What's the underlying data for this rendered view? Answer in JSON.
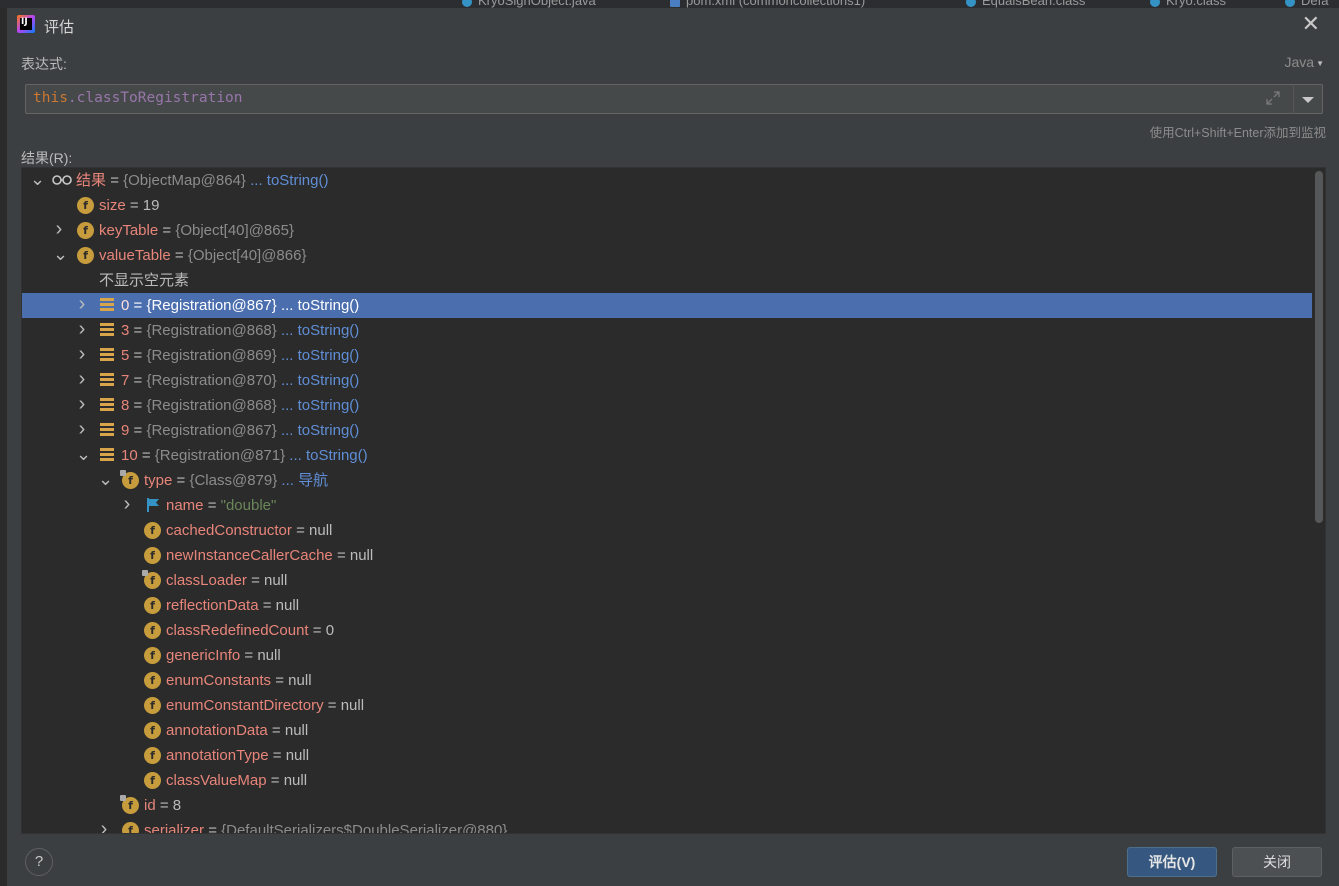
{
  "background_tabs": [
    {
      "label": "KryoSignObject.java"
    },
    {
      "label": "pom.xml (commoncollections1)"
    },
    {
      "label": "EqualsBean.class"
    },
    {
      "label": "Kryo.class"
    },
    {
      "label": "Defa"
    }
  ],
  "dialog": {
    "title": "评估",
    "expression_label": "表达式:",
    "language": "Java",
    "expression": {
      "keyword": "this",
      "rest": ".classToRegistration"
    },
    "hint": "使用Ctrl+Shift+Enter添加到监视",
    "result_label": "结果(R):",
    "buttons": {
      "help": "?",
      "evaluate": "评估(V)",
      "close": "关闭"
    }
  },
  "tree": {
    "root": {
      "name": "结果",
      "value": "{ObjectMap@864}",
      "link": "... toString()"
    },
    "size": {
      "name": "size",
      "value": "19"
    },
    "keyTable": {
      "name": "keyTable",
      "value": "{Object[40]@865}"
    },
    "valueTable": {
      "name": "valueTable",
      "value": "{Object[40]@866}"
    },
    "hide_empty": "不显示空元素",
    "entries": [
      {
        "index": "0",
        "value": "{Registration@867}",
        "link": "... toString()"
      },
      {
        "index": "3",
        "value": "{Registration@868}",
        "link": "... toString()"
      },
      {
        "index": "5",
        "value": "{Registration@869}",
        "link": "... toString()"
      },
      {
        "index": "7",
        "value": "{Registration@870}",
        "link": "... toString()"
      },
      {
        "index": "8",
        "value": "{Registration@868}",
        "link": "... toString()"
      },
      {
        "index": "9",
        "value": "{Registration@867}",
        "link": "... toString()"
      },
      {
        "index": "10",
        "value": "{Registration@871}",
        "link": "... toString()"
      }
    ],
    "type": {
      "name": "type",
      "value": "{Class@879}",
      "link": "... 导航"
    },
    "type_name": {
      "name": "name",
      "value": "\"double\""
    },
    "class_fields": [
      {
        "name": "cachedConstructor",
        "value": "null"
      },
      {
        "name": "newInstanceCallerCache",
        "value": "null"
      },
      {
        "name": "classLoader",
        "value": "null"
      },
      {
        "name": "reflectionData",
        "value": "null"
      },
      {
        "name": "classRedefinedCount",
        "value": "0"
      },
      {
        "name": "genericInfo",
        "value": "null"
      },
      {
        "name": "enumConstants",
        "value": "null"
      },
      {
        "name": "enumConstantDirectory",
        "value": "null"
      },
      {
        "name": "annotationData",
        "value": "null"
      },
      {
        "name": "annotationType",
        "value": "null"
      },
      {
        "name": "classValueMap",
        "value": "null"
      }
    ],
    "id": {
      "name": "id",
      "value": "8"
    },
    "serializer": {
      "name": "serializer",
      "value": "{DefaultSerializers$DoubleSerializer@880}"
    }
  }
}
